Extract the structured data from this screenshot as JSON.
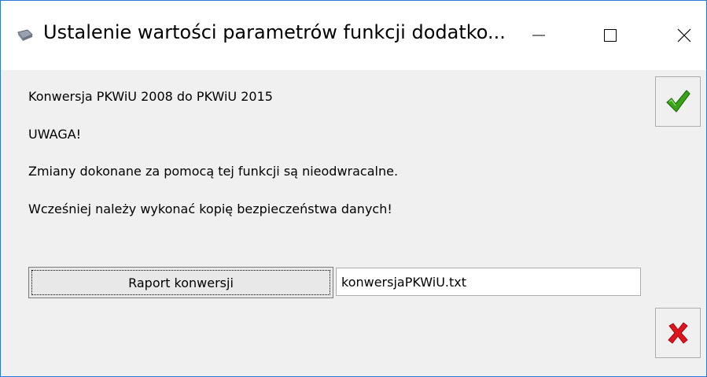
{
  "window": {
    "title": "Ustalenie wartości parametrów funkcji dodatko...",
    "icon": "gear-icon"
  },
  "messages": [
    "Konwersja PKWiU 2008 do PKWiU 2015",
    "UWAGA!",
    "Zmiany dokonane za pomocą tej funkcji są nieodwracalne.",
    "Wcześniej należy wykonać kopię bezpieczeństwa danych!"
  ],
  "report": {
    "button_label": "Raport konwersji",
    "file_value": "konwersjaPKWiU.txt"
  },
  "buttons": {
    "ok_icon": "checkmark-icon",
    "cancel_icon": "cross-icon"
  },
  "colors": {
    "accent": "#2b79d6",
    "ok_green": "#3aa31a",
    "cancel_red": "#e0141e"
  }
}
